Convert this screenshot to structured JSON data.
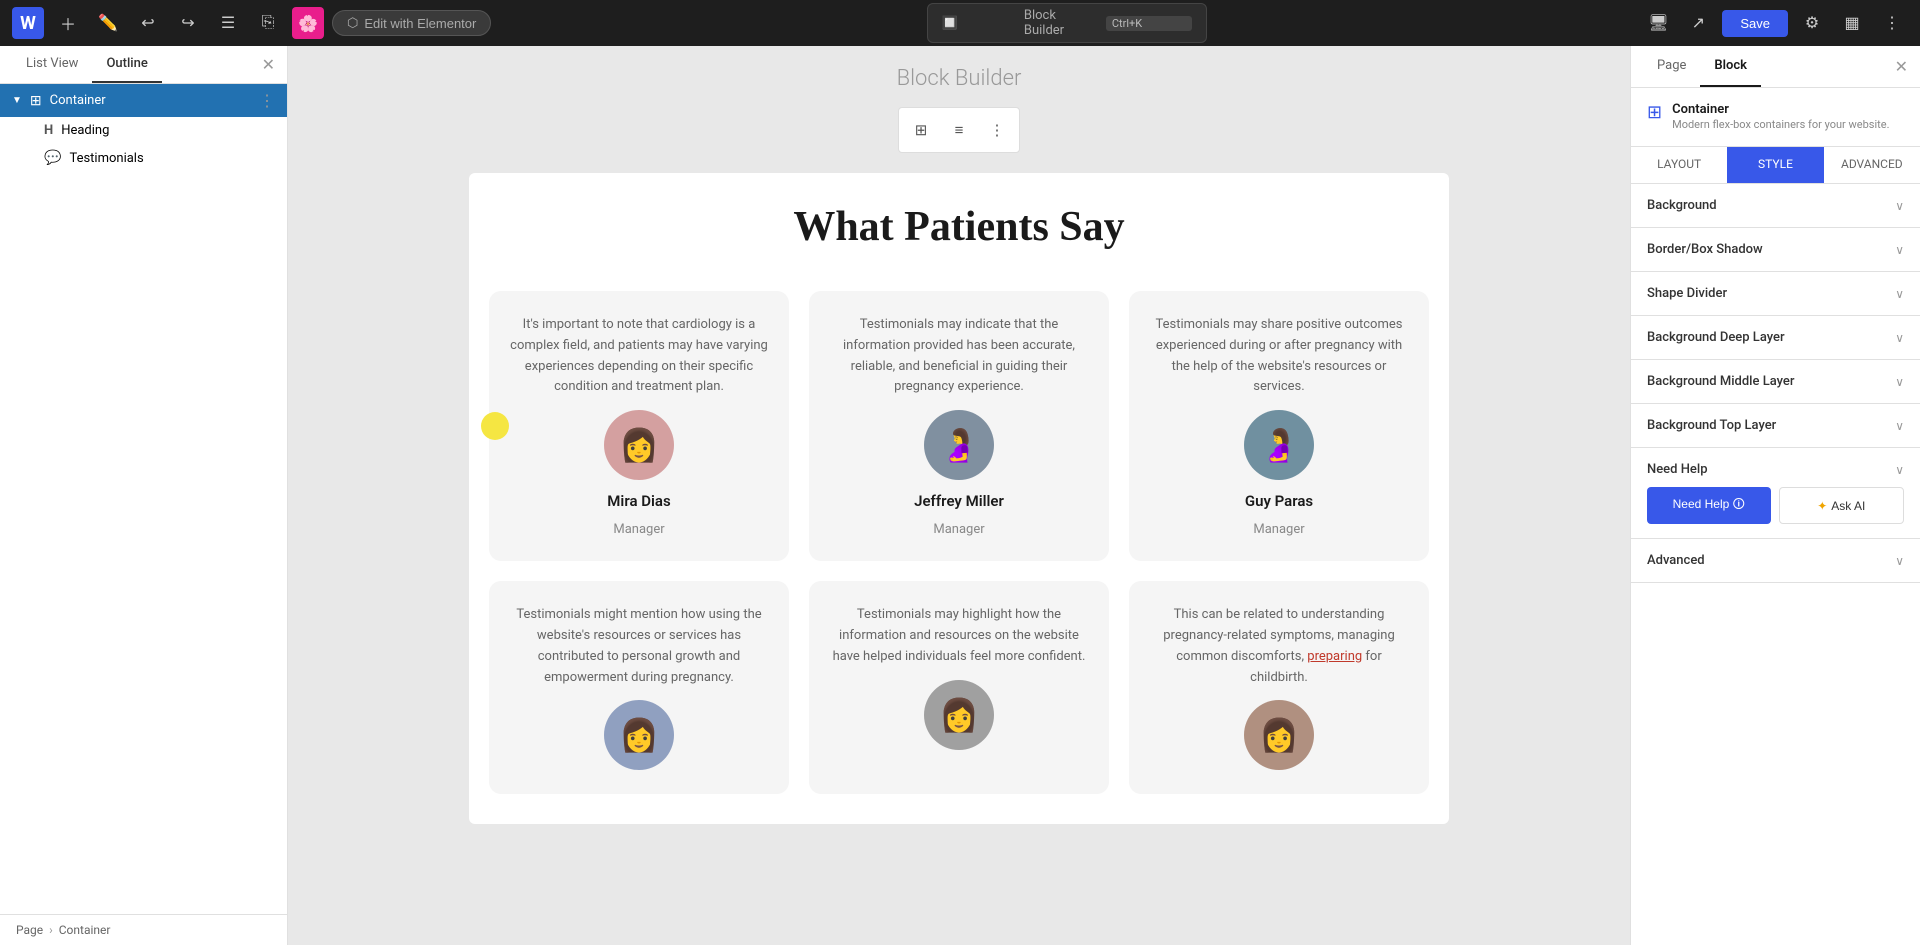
{
  "topbar": {
    "edit_btn_label": "Edit with Elementor",
    "search_placeholder": "Block Builder",
    "shortcut": "Ctrl+K",
    "save_label": "Save",
    "page_tab": "Page",
    "block_tab": "Block"
  },
  "left_sidebar": {
    "tab_list": "List View",
    "tab_outline": "Outline",
    "tree": [
      {
        "label": "Container",
        "type": "container",
        "active": true,
        "icon": "⊞"
      },
      {
        "label": "Heading",
        "type": "heading",
        "icon": "H",
        "child": true
      },
      {
        "label": "Testimonials",
        "type": "testimonials",
        "icon": "💬",
        "child": true
      }
    ]
  },
  "canvas": {
    "header": "Block Builder",
    "page_title": "What Patients Say",
    "testimonials": [
      {
        "text": "It's important to note that cardiology is a complex field, and patients may have varying experiences depending on their specific condition and treatment plan.",
        "name": "Mira Dias",
        "role": "Manager",
        "avatar": "👩"
      },
      {
        "text": "Testimonials may indicate that the information provided has been accurate, reliable, and beneficial in guiding their pregnancy experience.",
        "name": "Jeffrey Miller",
        "role": "Manager",
        "avatar": "🤰"
      },
      {
        "text": "Testimonials may share positive outcomes experienced during or after pregnancy with the help of the website's resources or services.",
        "name": "Guy Paras",
        "role": "Manager",
        "avatar": "🤰"
      },
      {
        "text": "Testimonials might mention how using the website's resources or services has contributed to personal growth and empowerment during pregnancy.",
        "name": "",
        "role": "",
        "avatar": "👩"
      },
      {
        "text": "Testimonials may highlight how the information and resources on the website have helped individuals feel more confident.",
        "name": "",
        "role": "",
        "avatar": "👩"
      },
      {
        "text": "This can be related to understanding pregnancy-related symptoms, managing common discomforts, preparing for childbirth.",
        "name": "",
        "role": "",
        "avatar": "👩",
        "has_link": true,
        "link_text": "preparing"
      }
    ]
  },
  "breadcrumb": {
    "root": "Page",
    "current": "Container"
  },
  "right_sidebar": {
    "tab_page": "Page",
    "tab_block": "Block",
    "container_label": "Container",
    "container_desc": "Modern flex-box containers for your website.",
    "style_tabs": [
      "LAYOUT",
      "STYLE",
      "ADVANCED"
    ],
    "active_style_tab": "STYLE",
    "accordion_items": [
      {
        "label": "Background"
      },
      {
        "label": "Border/Box Shadow"
      },
      {
        "label": "Shape Divider"
      },
      {
        "label": "Background Deep Layer"
      },
      {
        "label": "Background Middle Layer"
      },
      {
        "label": "Background Top Layer"
      }
    ],
    "need_help_label": "Need Help",
    "need_help_btn": "Need Help 🛈",
    "ask_ai_btn": "Ask AI",
    "advanced_label": "Advanced"
  }
}
